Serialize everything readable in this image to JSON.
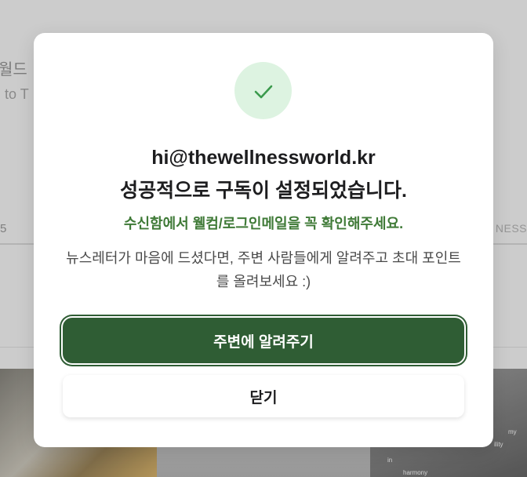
{
  "background": {
    "title_fragment": "월드",
    "subtitle_fragment": "to T",
    "number_fragment": "5",
    "right_fragment": "NESS",
    "photo_text_1": "my",
    "photo_text_2": "ility",
    "photo_text_3": "in",
    "photo_text_4": "harmony"
  },
  "modal": {
    "icon": "check-icon",
    "email": "hi@thewellnessworld.kr",
    "success_message": "성공적으로 구독이 설정되었습니다.",
    "welcome_message": "수신함에서 웰컴/로그인메일을 꼭 확인해주세요.",
    "share_message": "뉴스레터가 마음에 드셨다면, 주변 사람들에게 알려주고 초대 포인트를 올려보세요 :)",
    "share_button_label": "주변에 알려주기",
    "close_button_label": "닫기"
  },
  "colors": {
    "accent_green": "#2f5d34",
    "welcome_green": "#3f7a37",
    "check_bg": "#ddf3e1",
    "check_stroke": "#3b9a4d"
  }
}
